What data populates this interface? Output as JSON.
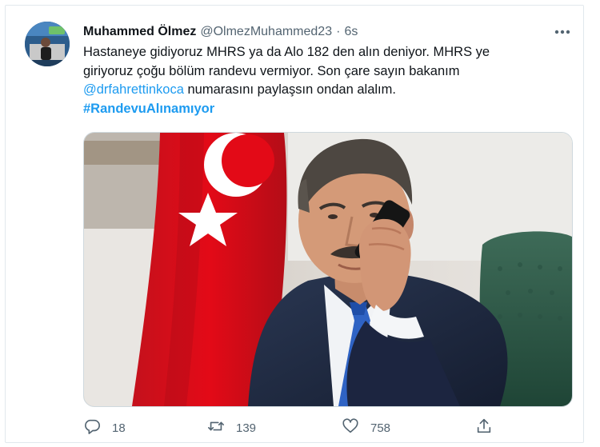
{
  "tweet": {
    "author_name": "Muhammed Ölmez",
    "author_handle": "@OlmezMuhammed23",
    "separator": "·",
    "time": "6s",
    "text_line1": "Hastaneye gidiyoruz MHRS ya da Alo 182 den alın deniyor. MHRS ye",
    "text_line2": "giriyoruz çoğu bölüm randevu vermiyor. Son çare sayın bakanım",
    "mention": "@drfahrettinkoca",
    "text_line3_rest": " numarasını paylaşsın ondan alalım.",
    "hashtag": "#RandevuAlınamıyor"
  },
  "actions": {
    "reply_count": "18",
    "retweet_count": "139",
    "like_count": "758"
  },
  "icons": {
    "more": "more-icon",
    "reply": "reply-icon",
    "retweet": "retweet-icon",
    "like": "like-icon",
    "share": "share-icon"
  },
  "colors": {
    "link": "#1d9bf0",
    "muted": "#536471",
    "text": "#0f1419",
    "flag_red": "#e30a17"
  }
}
